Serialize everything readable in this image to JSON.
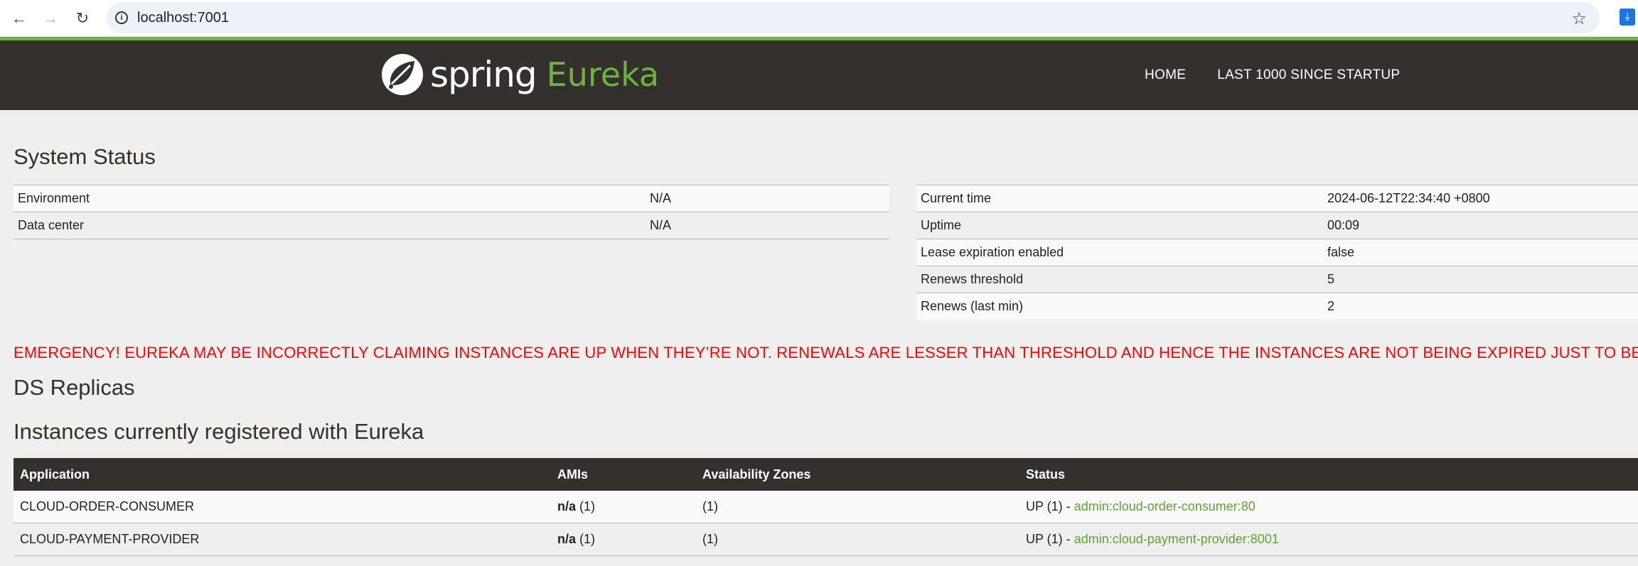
{
  "browser": {
    "url": "localhost:7001",
    "back_icon": "←",
    "forward_icon": "→",
    "reload_icon": "↻",
    "star_icon": "☆",
    "download_icon": "⤓"
  },
  "header": {
    "brand_spring": "spring",
    "brand_eureka": "Eureka",
    "nav": [
      "HOME",
      "LAST 1000 SINCE STARTUP"
    ],
    "accent_color": "#6db33f",
    "bar_color": "#34302d"
  },
  "system_status": {
    "title": "System Status",
    "left": [
      {
        "label": "Environment",
        "value": "N/A"
      },
      {
        "label": "Data center",
        "value": "N/A"
      }
    ],
    "right": [
      {
        "label": "Current time",
        "value": "2024-06-12T22:34:40 +0800"
      },
      {
        "label": "Uptime",
        "value": "00:09"
      },
      {
        "label": "Lease expiration enabled",
        "value": "false"
      },
      {
        "label": "Renews threshold",
        "value": "5"
      },
      {
        "label": "Renews (last min)",
        "value": "2"
      }
    ]
  },
  "emergency": "EMERGENCY! EUREKA MAY BE INCORRECTLY CLAIMING INSTANCES ARE UP WHEN THEY’RE NOT. RENEWALS ARE LESSER THAN THRESHOLD AND HENCE THE INSTANCES ARE NOT BEING EXPIRED JUST TO BE SAFE.",
  "ds_replicas": {
    "title": "DS Replicas"
  },
  "instances": {
    "title": "Instances currently registered with Eureka",
    "columns": [
      "Application",
      "AMIs",
      "Availability Zones",
      "Status"
    ],
    "rows": [
      {
        "application": "CLOUD-ORDER-CONSUMER",
        "ami_label": "n/a",
        "ami_count": "(1)",
        "zones": "(1)",
        "status_prefix": "UP (1) - ",
        "status_link": "admin:cloud-order-consumer:80"
      },
      {
        "application": "CLOUD-PAYMENT-PROVIDER",
        "ami_label": "n/a",
        "ami_count": "(1)",
        "zones": "(1)",
        "status_prefix": "UP (1) - ",
        "status_link": "admin:cloud-payment-provider:8001"
      }
    ]
  }
}
